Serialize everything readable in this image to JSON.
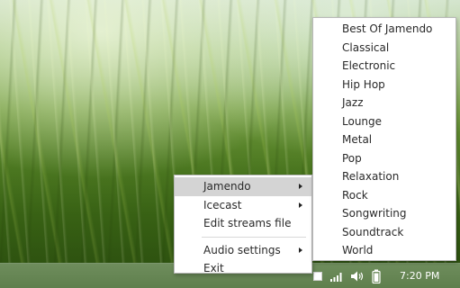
{
  "desktop": {
    "wallpaper_icon": "grass-wallpaper"
  },
  "main_menu": {
    "items": [
      {
        "label": "Jamendo",
        "has_submenu": true,
        "active": true
      },
      {
        "label": "Icecast",
        "has_submenu": true,
        "active": false
      },
      {
        "label": "Edit streams file",
        "has_submenu": false,
        "active": false
      },
      {
        "label": "Audio settings",
        "has_submenu": true,
        "active": false
      },
      {
        "label": "Exit",
        "has_submenu": false,
        "active": false
      }
    ]
  },
  "submenu": {
    "items": [
      {
        "label": "Best Of Jamendo"
      },
      {
        "label": "Classical"
      },
      {
        "label": "Electronic"
      },
      {
        "label": "Hip Hop"
      },
      {
        "label": "Jazz"
      },
      {
        "label": "Lounge"
      },
      {
        "label": "Metal"
      },
      {
        "label": "Pop"
      },
      {
        "label": "Relaxation"
      },
      {
        "label": "Rock"
      },
      {
        "label": "Songwriting"
      },
      {
        "label": "Soundtrack"
      },
      {
        "label": "World"
      }
    ]
  },
  "taskbar": {
    "clock": "7:20 PM",
    "icons": [
      "radio-tray-icon",
      "signal-icon",
      "volume-icon",
      "battery-icon"
    ]
  },
  "colors": {
    "menu_background": "#ffffff",
    "menu_highlight": "#d4d4d4",
    "taskbar": "#647f52"
  }
}
